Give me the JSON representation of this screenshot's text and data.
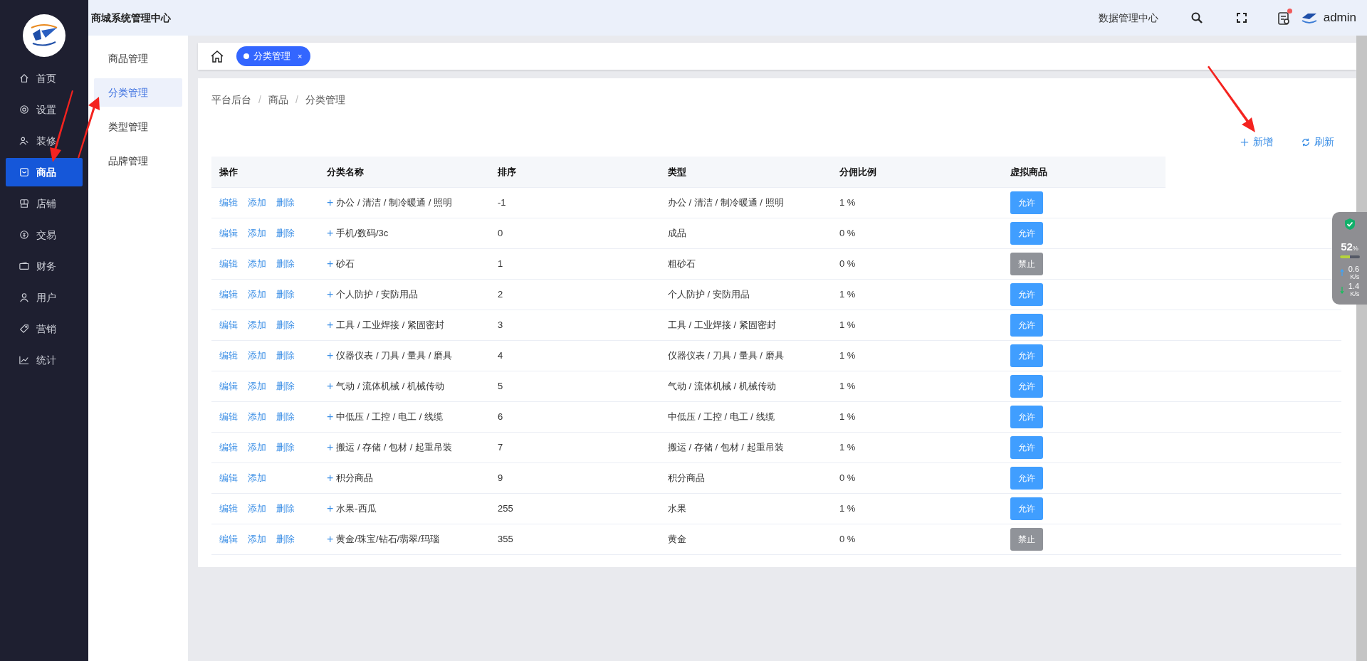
{
  "header": {
    "title": "商城系统管理中心",
    "data_center": "数据管理中心",
    "notification": true,
    "user": "admin"
  },
  "nav": [
    {
      "label": "首页",
      "selected": false
    },
    {
      "label": "设置",
      "selected": false
    },
    {
      "label": "装修",
      "selected": false
    },
    {
      "label": "商品",
      "selected": true
    },
    {
      "label": "店铺",
      "selected": false
    },
    {
      "label": "交易",
      "selected": false
    },
    {
      "label": "财务",
      "selected": false
    },
    {
      "label": "用户",
      "selected": false
    },
    {
      "label": "营销",
      "selected": false
    },
    {
      "label": "统计",
      "selected": false
    }
  ],
  "submenu": [
    {
      "label": "商品管理",
      "selected": false
    },
    {
      "label": "分类管理",
      "selected": true
    },
    {
      "label": "类型管理",
      "selected": false
    },
    {
      "label": "品牌管理",
      "selected": false
    }
  ],
  "tabs": [
    {
      "label": "分类管理",
      "selected": true,
      "close": "×"
    }
  ],
  "breadcrumb": [
    "平台后台",
    "商品",
    "分类管理"
  ],
  "breadcrumb_separator": "/",
  "toolbar": [
    {
      "label": "新增"
    },
    {
      "label": "刷新"
    }
  ],
  "table": {
    "columns": [
      "操作",
      "分类名称",
      "排序",
      "类型",
      "分佣比例",
      "虚拟商品"
    ],
    "rows": [
      {
        "actions": [
          "编辑",
          "添加",
          "删除"
        ],
        "expand": "+",
        "name": "办公 / 清洁 / 制冷暖通 / 照明",
        "sort": "-1",
        "type": "办公 / 清洁 / 制冷暖通 / 照明",
        "commission": "1 %",
        "virtual": {
          "label": "允许",
          "allowed": true
        }
      },
      {
        "actions": [
          "编辑",
          "添加",
          "删除"
        ],
        "expand": "+",
        "name": "手机/数码/3c",
        "sort": "0",
        "type": "成品",
        "commission": "0 %",
        "virtual": {
          "label": "允许",
          "allowed": true
        }
      },
      {
        "actions": [
          "编辑",
          "添加",
          "删除"
        ],
        "expand": "+",
        "name": "砂石",
        "sort": "1",
        "type": "粗砂石",
        "commission": "0 %",
        "virtual": {
          "label": "禁止",
          "allowed": false
        }
      },
      {
        "actions": [
          "编辑",
          "添加",
          "删除"
        ],
        "expand": "+",
        "name": "个人防护 / 安防用品",
        "sort": "2",
        "type": "个人防护 / 安防用品",
        "commission": "1 %",
        "virtual": {
          "label": "允许",
          "allowed": true
        }
      },
      {
        "actions": [
          "编辑",
          "添加",
          "删除"
        ],
        "expand": "+",
        "name": "工具 / 工业焊接 / 紧固密封",
        "sort": "3",
        "type": "工具 / 工业焊接 / 紧固密封",
        "commission": "1 %",
        "virtual": {
          "label": "允许",
          "allowed": true
        }
      },
      {
        "actions": [
          "编辑",
          "添加",
          "删除"
        ],
        "expand": "+",
        "name": "仪器仪表 / 刀具 / 量具 / 磨具",
        "sort": "4",
        "type": "仪器仪表 / 刀具 / 量具 / 磨具",
        "commission": "1 %",
        "virtual": {
          "label": "允许",
          "allowed": true
        }
      },
      {
        "actions": [
          "编辑",
          "添加",
          "删除"
        ],
        "expand": "+",
        "name": "气动 / 流体机械 / 机械传动",
        "sort": "5",
        "type": "气动 / 流体机械 / 机械传动",
        "commission": "1 %",
        "virtual": {
          "label": "允许",
          "allowed": true
        }
      },
      {
        "actions": [
          "编辑",
          "添加",
          "删除"
        ],
        "expand": "+",
        "name": "中低压 / 工控 / 电工 / 线缆",
        "sort": "6",
        "type": "中低压 / 工控 / 电工 / 线缆",
        "commission": "1 %",
        "virtual": {
          "label": "允许",
          "allowed": true
        }
      },
      {
        "actions": [
          "编辑",
          "添加",
          "删除"
        ],
        "expand": "+",
        "name": "搬运 / 存储 / 包材 / 起重吊装",
        "sort": "7",
        "type": "搬运 / 存储 / 包材 / 起重吊装",
        "commission": "1 %",
        "virtual": {
          "label": "允许",
          "allowed": true
        }
      },
      {
        "actions": [
          "编辑",
          "添加"
        ],
        "expand": "+",
        "name": "积分商品",
        "sort": "9",
        "type": "积分商品",
        "commission": "0 %",
        "virtual": {
          "label": "允许",
          "allowed": true
        }
      },
      {
        "actions": [
          "编辑",
          "添加",
          "删除"
        ],
        "expand": "+",
        "name": "水果-西瓜",
        "sort": "255",
        "type": "水果",
        "commission": "1 %",
        "virtual": {
          "label": "允许",
          "allowed": true
        }
      },
      {
        "actions": [
          "编辑",
          "添加",
          "删除"
        ],
        "expand": "+",
        "name": "黄金/珠宝/钻石/翡翠/玛瑙",
        "sort": "355",
        "type": "黄金",
        "commission": "0 %",
        "virtual": {
          "label": "禁止",
          "allowed": false
        }
      }
    ]
  },
  "monitor": {
    "percent": "52",
    "percent_unit": "%",
    "level": 0.52,
    "upload": {
      "value": "0.6",
      "unit": "K/s"
    },
    "download": {
      "value": "1.4",
      "unit": "K/s"
    }
  }
}
